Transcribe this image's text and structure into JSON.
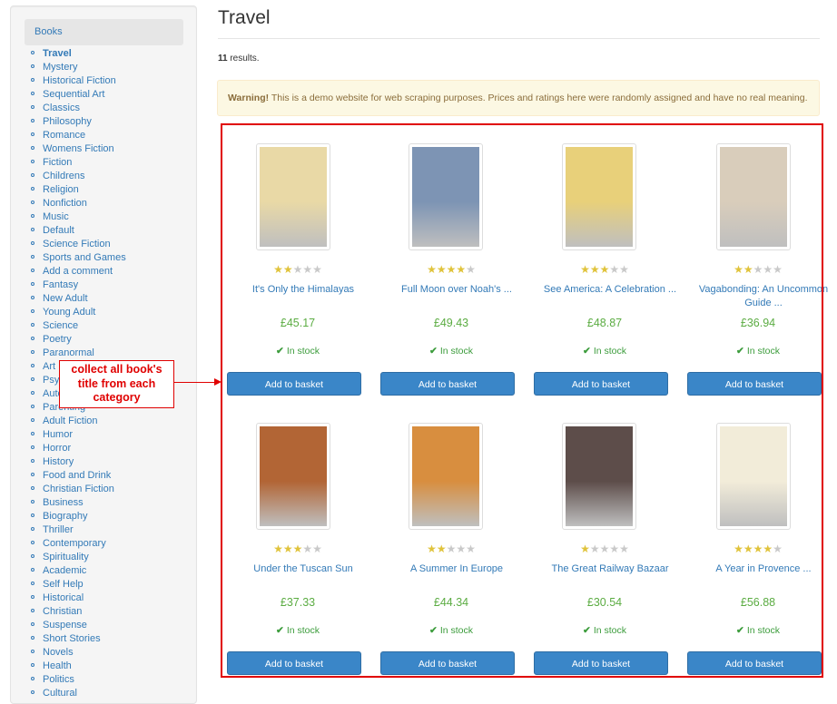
{
  "sidebar": {
    "heading": "Books",
    "categories": [
      "Travel",
      "Mystery",
      "Historical Fiction",
      "Sequential Art",
      "Classics",
      "Philosophy",
      "Romance",
      "Womens Fiction",
      "Fiction",
      "Childrens",
      "Religion",
      "Nonfiction",
      "Music",
      "Default",
      "Science Fiction",
      "Sports and Games",
      "Add a comment",
      "Fantasy",
      "New Adult",
      "Young Adult",
      "Science",
      "Poetry",
      "Paranormal",
      "Art",
      "Psychology",
      "Autobiography",
      "Parenting",
      "Adult Fiction",
      "Humor",
      "Horror",
      "History",
      "Food and Drink",
      "Christian Fiction",
      "Business",
      "Biography",
      "Thriller",
      "Contemporary",
      "Spirituality",
      "Academic",
      "Self Help",
      "Historical",
      "Christian",
      "Suspense",
      "Short Stories",
      "Novels",
      "Health",
      "Politics",
      "Cultural"
    ],
    "active_index": 0
  },
  "page": {
    "title": "Travel",
    "results_count": "11",
    "results_suffix": " results."
  },
  "alert": {
    "strong": "Warning!",
    "text": " This is a demo website for web scraping purposes. Prices and ratings here were randomly assigned and have no real meaning."
  },
  "annotation": {
    "text": "collect all book's title from each category",
    "color": "#e00000"
  },
  "products": [
    {
      "title": "It's Only the Himalayas",
      "price": "£45.17",
      "stars": 2,
      "stock": "In stock",
      "button": "Add to basket",
      "cover_color": "#e9d9a6"
    },
    {
      "title": "Full Moon over Noah's ...",
      "price": "£49.43",
      "stars": 4,
      "stock": "In stock",
      "button": "Add to basket",
      "cover_color": "#7d94b4"
    },
    {
      "title": "See America: A Celebration ...",
      "price": "£48.87",
      "stars": 3,
      "stock": "In stock",
      "button": "Add to basket",
      "cover_color": "#e8d07a"
    },
    {
      "title": "Vagabonding: An Uncommon Guide ...",
      "price": "£36.94",
      "stars": 2,
      "stock": "In stock",
      "button": "Add to basket",
      "cover_color": "#d9cdbb"
    },
    {
      "title": "Under the Tuscan Sun",
      "price": "£37.33",
      "stars": 3,
      "stock": "In stock",
      "button": "Add to basket",
      "cover_color": "#b26535"
    },
    {
      "title": "A Summer In Europe",
      "price": "£44.34",
      "stars": 2,
      "stock": "In stock",
      "button": "Add to basket",
      "cover_color": "#d88e3f"
    },
    {
      "title": "The Great Railway Bazaar",
      "price": "£30.54",
      "stars": 1,
      "stock": "In stock",
      "button": "Add to basket",
      "cover_color": "#5d4d4a"
    },
    {
      "title": "A Year in Provence ...",
      "price": "£56.88",
      "stars": 4,
      "stock": "In stock",
      "button": "Add to basket",
      "cover_color": "#f2ecd9"
    }
  ],
  "colors": {
    "link": "#337ab7",
    "price": "#5bac42",
    "stock": "#3c9c3c",
    "button": "#3a86c8",
    "star_on": "#e0c33b",
    "star_off": "#c9c9c9",
    "alert_bg": "#fcf8e3",
    "alert_text": "#8a6d3b"
  },
  "icons": {
    "check": "check-icon",
    "star": "star-icon",
    "bullet": "circle-bullet-icon"
  }
}
